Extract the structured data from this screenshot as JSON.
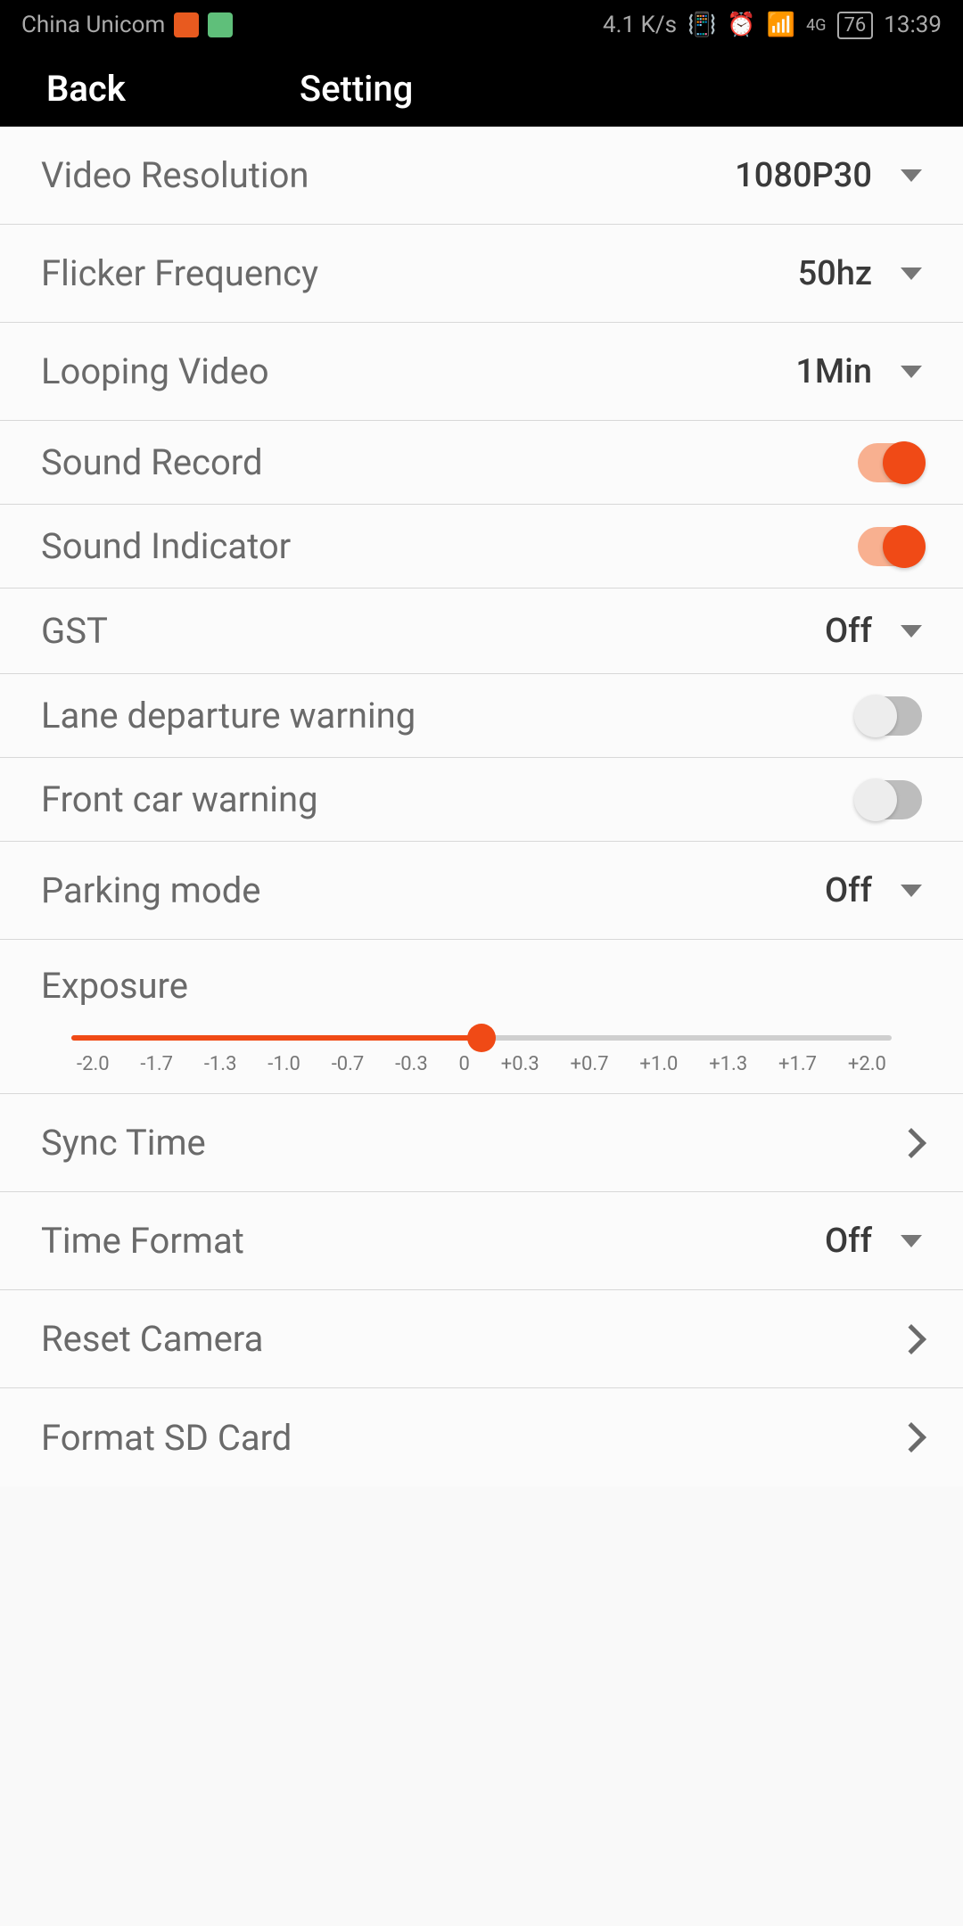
{
  "status_bar": {
    "carrier": "China Unicom",
    "speed": "4.1 K/s",
    "network": "4G",
    "battery": "76",
    "time": "13:39"
  },
  "header": {
    "back": "Back",
    "title": "Setting"
  },
  "settings": {
    "video_resolution": {
      "label": "Video Resolution",
      "value": "1080P30"
    },
    "flicker_frequency": {
      "label": "Flicker Frequency",
      "value": "50hz"
    },
    "looping_video": {
      "label": "Looping Video",
      "value": "1Min"
    },
    "sound_record": {
      "label": "Sound Record"
    },
    "sound_indicator": {
      "label": "Sound Indicator"
    },
    "gst": {
      "label": "GST",
      "value": "Off"
    },
    "lane_departure": {
      "label": "Lane departure warning"
    },
    "front_car": {
      "label": "Front car warning"
    },
    "parking_mode": {
      "label": "Parking mode",
      "value": "Off"
    },
    "exposure": {
      "label": "Exposure"
    },
    "sync_time": {
      "label": "Sync Time"
    },
    "time_format": {
      "label": "Time Format",
      "value": "Off"
    },
    "reset_camera": {
      "label": "Reset Camera"
    },
    "format_sd": {
      "label": "Format SD Card"
    }
  },
  "exposure_ticks": [
    "-2.0",
    "-1.7",
    "-1.3",
    "-1.0",
    "-0.7",
    "-0.3",
    "0",
    "+0.3",
    "+0.7",
    "+1.0",
    "+1.3",
    "+1.7",
    "+2.0"
  ]
}
